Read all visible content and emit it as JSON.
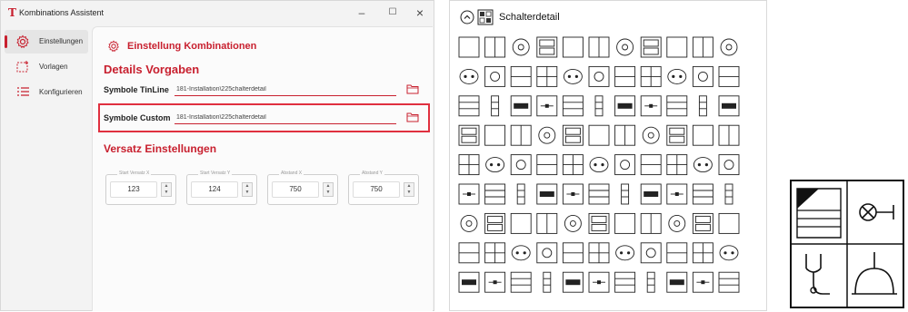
{
  "window": {
    "logo": "T",
    "title": "Kombinations Assistent",
    "minimize": "–",
    "maximize": "☐",
    "close": "×"
  },
  "nav": {
    "items": [
      {
        "label": "Einstellungen",
        "icon": "gear-icon",
        "active": true
      },
      {
        "label": "Vorlagen",
        "icon": "template-icon",
        "active": false
      },
      {
        "label": "Konfigurieren",
        "icon": "list-settings-icon",
        "active": false
      }
    ]
  },
  "settings": {
    "heading": "Einstellung Kombinationen",
    "details_heading": "Details Vorgaben",
    "tinline_label": "Symbole TinLine",
    "tinline_path": "181-Installation\\225chalterdetail",
    "custom_label": "Symbole Custom",
    "custom_path": "181-Installation\\225chalterdetail",
    "offset_heading": "Versatz Einstellungen",
    "fields": [
      {
        "legend": "Start Versatz X",
        "value": "123"
      },
      {
        "legend": "Start Versatz Y",
        "value": "124"
      },
      {
        "legend": "Abstand X",
        "value": "750"
      },
      {
        "legend": "Abstand Y",
        "value": "750"
      }
    ]
  },
  "detail": {
    "title": "Schalterdetail"
  },
  "colors": {
    "accent": "#c8202f",
    "highlight": "#e0303f"
  }
}
